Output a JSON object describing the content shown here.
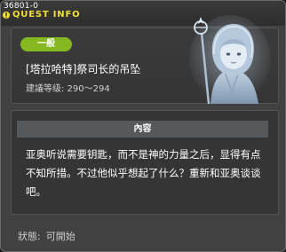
{
  "window": {
    "quest_id": "36801-0",
    "title": "QUEST INFO"
  },
  "header": {
    "category": "一般",
    "quest_name": "[塔拉哈特]祭司长的吊坠",
    "level_range": "建議等级: 290〜294"
  },
  "content": {
    "section_label": "內容",
    "description": "亚奥听说需要钥匙，而不是神的力量之后，显得有点不知所措。不过他似乎想起了什么？重新和亚奥谈谈吧。"
  },
  "status": {
    "label": "狀態:",
    "value": "可開始"
  },
  "colors": {
    "title": "#f1de3a",
    "badge": "#86b81f",
    "window_bg": "#414141"
  },
  "icons": [
    "quest-info-icon",
    "priest-portrait"
  ]
}
